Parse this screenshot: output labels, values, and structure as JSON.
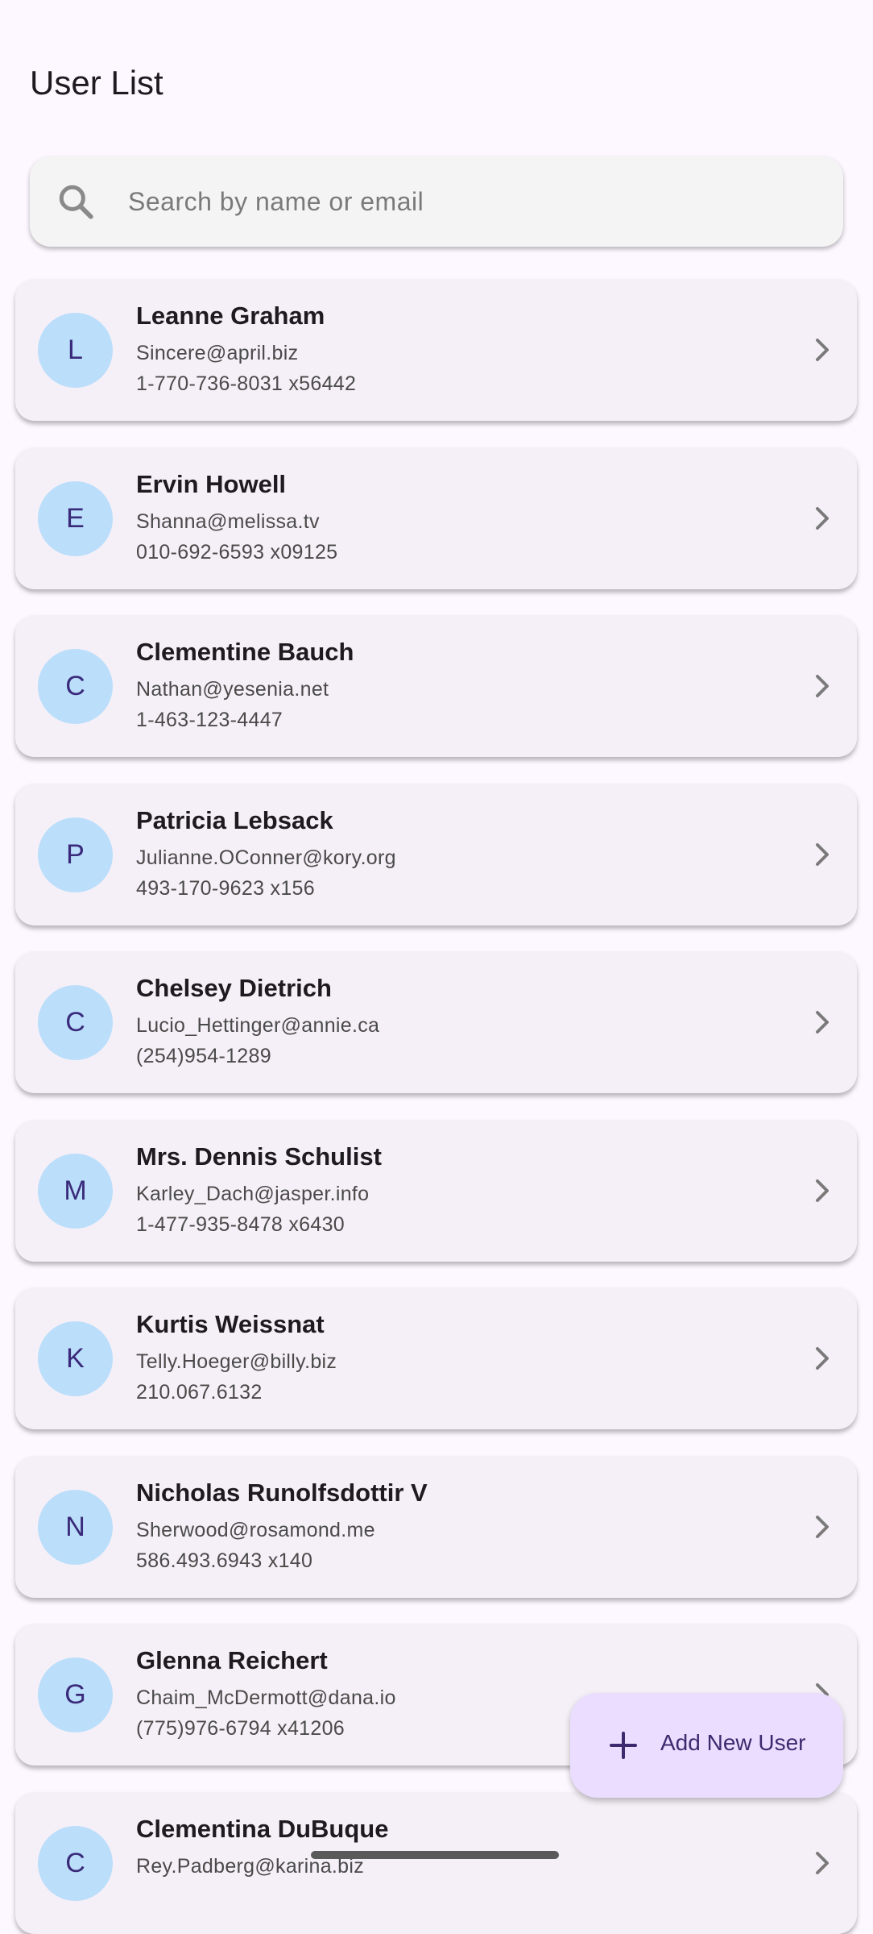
{
  "app_bar": {
    "title": "User List"
  },
  "search": {
    "placeholder": "Search by name or email",
    "value": "",
    "icon": "search-icon"
  },
  "users": [
    {
      "initial": "L",
      "name": "Leanne Graham",
      "email": "Sincere@april.biz",
      "phone": "1-770-736-8031 x56442"
    },
    {
      "initial": "E",
      "name": "Ervin Howell",
      "email": "Shanna@melissa.tv",
      "phone": "010-692-6593 x09125"
    },
    {
      "initial": "C",
      "name": "Clementine Bauch",
      "email": "Nathan@yesenia.net",
      "phone": "1-463-123-4447"
    },
    {
      "initial": "P",
      "name": "Patricia Lebsack",
      "email": "Julianne.OConner@kory.org",
      "phone": "493-170-9623 x156"
    },
    {
      "initial": "C",
      "name": "Chelsey Dietrich",
      "email": "Lucio_Hettinger@annie.ca",
      "phone": "(254)954-1289"
    },
    {
      "initial": "M",
      "name": "Mrs. Dennis Schulist",
      "email": "Karley_Dach@jasper.info",
      "phone": "1-477-935-8478 x6430"
    },
    {
      "initial": "K",
      "name": "Kurtis Weissnat",
      "email": "Telly.Hoeger@billy.biz",
      "phone": "210.067.6132"
    },
    {
      "initial": "N",
      "name": "Nicholas Runolfsdottir V",
      "email": "Sherwood@rosamond.me",
      "phone": "586.493.6943 x140"
    },
    {
      "initial": "G",
      "name": "Glenna Reichert",
      "email": "Chaim_McDermott@dana.io",
      "phone": "(775)976-6794 x41206"
    },
    {
      "initial": "C",
      "name": "Clementina DuBuque",
      "email": "Rey.Padberg@karina.biz",
      "phone": ""
    }
  ],
  "fab": {
    "label": "Add New User",
    "icon": "plus-icon"
  },
  "colors": {
    "background": "#fdf7ff",
    "card": "#f5f0f7",
    "avatar": "#bbdefb",
    "fab": "#eaddff",
    "accent": "#3d2a6e"
  }
}
